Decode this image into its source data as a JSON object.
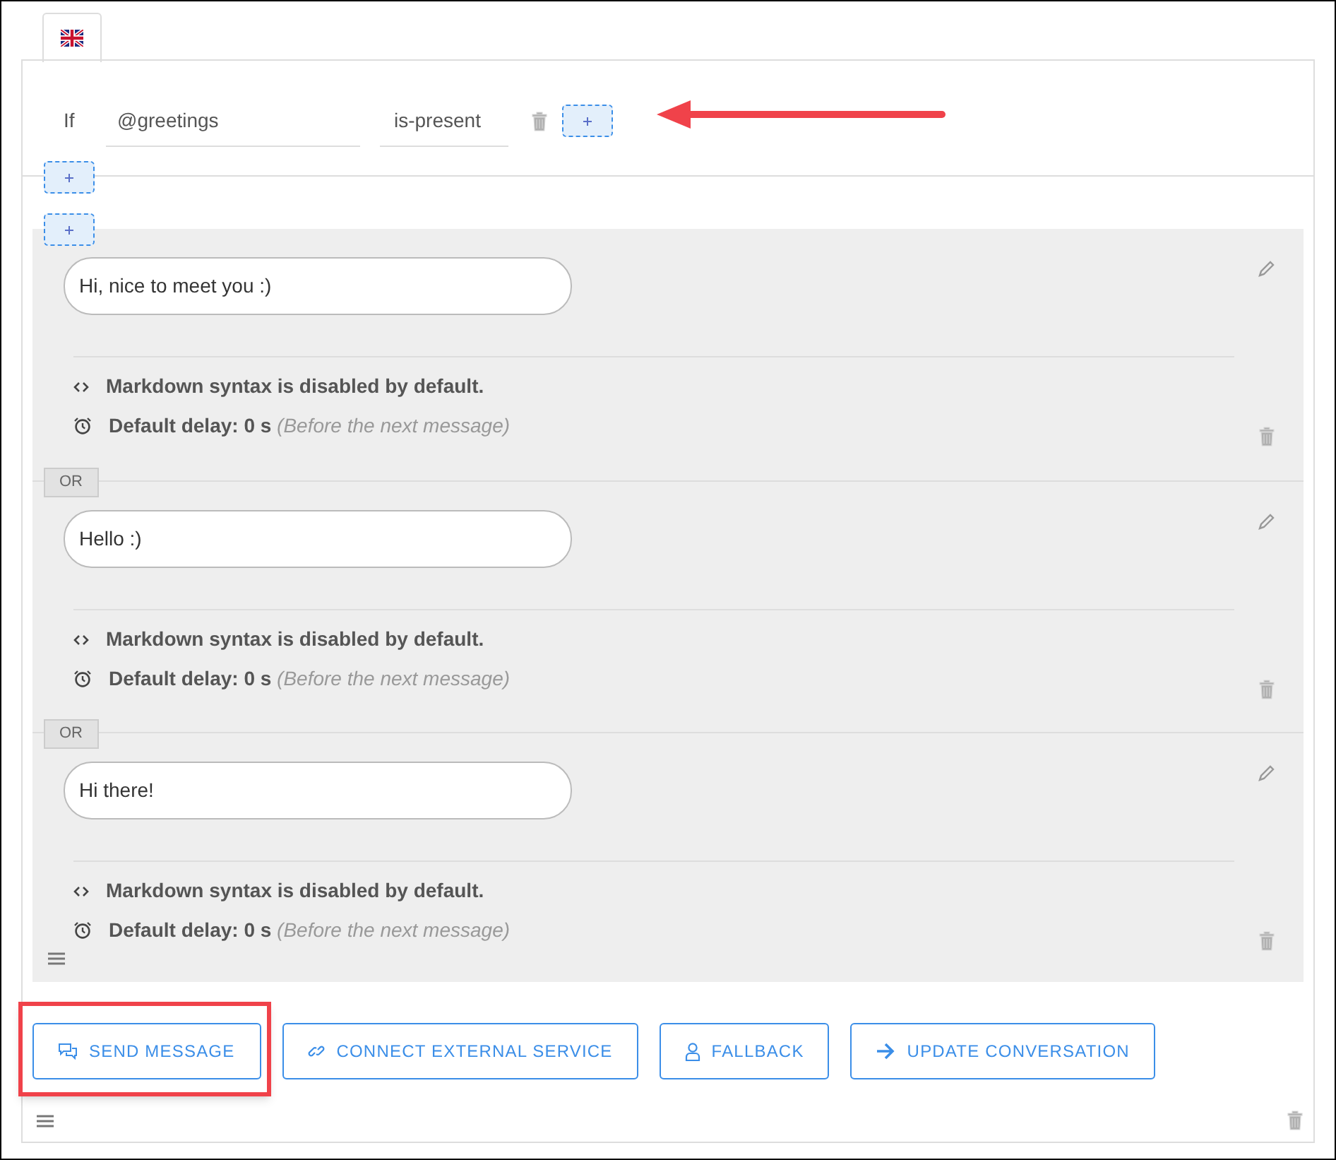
{
  "language_tabs": [
    {
      "kind": "flag_uk",
      "selected": true
    }
  ],
  "condition": {
    "label": "If",
    "variable": "@greetings",
    "operator": "is-present"
  },
  "annotations": {
    "arrow_to_add_condition": true
  },
  "messages": [
    {
      "text": "Hi, nice to meet you :)",
      "markdown_note": "Markdown syntax is disabled by default.",
      "delay": "**Default delay: 0 s** *(Before the next message)*"
    },
    {
      "separator": "OR",
      "text": "Hello :)",
      "markdown_note": "Markdown syntax is disabled by default.",
      "delay": "**Default delay: 0 s** *(Before the next message)*"
    },
    {
      "separator": "OR",
      "text": "Hi there!",
      "markdown_note": "Markdown syntax is disabled by default.",
      "delay": "**Default delay: 0 s** *(Before the next message)*"
    }
  ],
  "actions": [
    {
      "kind": "message",
      "label": "SEND MESSAGE",
      "highlighted": true
    },
    {
      "kind": "link",
      "label": "CONNECT EXTERNAL SERVICE",
      "highlighted": false
    },
    {
      "kind": "person",
      "label": "FALLBACK",
      "highlighted": false
    },
    {
      "kind": "arrow",
      "label": "UPDATE CONVERSATION",
      "highlighted": false
    }
  ]
}
